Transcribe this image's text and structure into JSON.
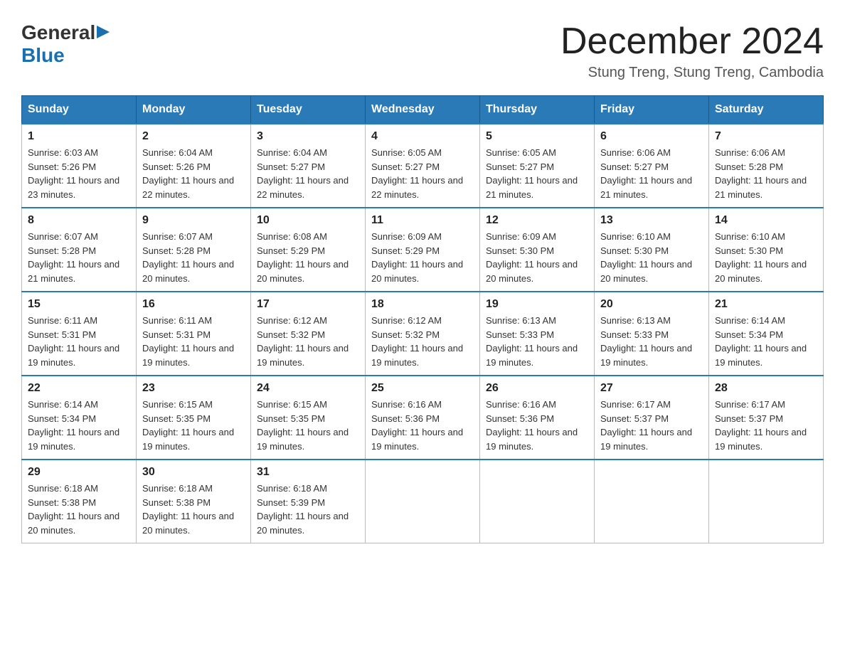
{
  "logo": {
    "general": "General",
    "blue": "Blue",
    "triangle": "▶"
  },
  "title": {
    "month": "December 2024",
    "location": "Stung Treng, Stung Treng, Cambodia"
  },
  "headers": [
    "Sunday",
    "Monday",
    "Tuesday",
    "Wednesday",
    "Thursday",
    "Friday",
    "Saturday"
  ],
  "weeks": [
    [
      {
        "day": "1",
        "sunrise": "6:03 AM",
        "sunset": "5:26 PM",
        "daylight": "11 hours and 23 minutes."
      },
      {
        "day": "2",
        "sunrise": "6:04 AM",
        "sunset": "5:26 PM",
        "daylight": "11 hours and 22 minutes."
      },
      {
        "day": "3",
        "sunrise": "6:04 AM",
        "sunset": "5:27 PM",
        "daylight": "11 hours and 22 minutes."
      },
      {
        "day": "4",
        "sunrise": "6:05 AM",
        "sunset": "5:27 PM",
        "daylight": "11 hours and 22 minutes."
      },
      {
        "day": "5",
        "sunrise": "6:05 AM",
        "sunset": "5:27 PM",
        "daylight": "11 hours and 21 minutes."
      },
      {
        "day": "6",
        "sunrise": "6:06 AM",
        "sunset": "5:27 PM",
        "daylight": "11 hours and 21 minutes."
      },
      {
        "day": "7",
        "sunrise": "6:06 AM",
        "sunset": "5:28 PM",
        "daylight": "11 hours and 21 minutes."
      }
    ],
    [
      {
        "day": "8",
        "sunrise": "6:07 AM",
        "sunset": "5:28 PM",
        "daylight": "11 hours and 21 minutes."
      },
      {
        "day": "9",
        "sunrise": "6:07 AM",
        "sunset": "5:28 PM",
        "daylight": "11 hours and 20 minutes."
      },
      {
        "day": "10",
        "sunrise": "6:08 AM",
        "sunset": "5:29 PM",
        "daylight": "11 hours and 20 minutes."
      },
      {
        "day": "11",
        "sunrise": "6:09 AM",
        "sunset": "5:29 PM",
        "daylight": "11 hours and 20 minutes."
      },
      {
        "day": "12",
        "sunrise": "6:09 AM",
        "sunset": "5:30 PM",
        "daylight": "11 hours and 20 minutes."
      },
      {
        "day": "13",
        "sunrise": "6:10 AM",
        "sunset": "5:30 PM",
        "daylight": "11 hours and 20 minutes."
      },
      {
        "day": "14",
        "sunrise": "6:10 AM",
        "sunset": "5:30 PM",
        "daylight": "11 hours and 20 minutes."
      }
    ],
    [
      {
        "day": "15",
        "sunrise": "6:11 AM",
        "sunset": "5:31 PM",
        "daylight": "11 hours and 19 minutes."
      },
      {
        "day": "16",
        "sunrise": "6:11 AM",
        "sunset": "5:31 PM",
        "daylight": "11 hours and 19 minutes."
      },
      {
        "day": "17",
        "sunrise": "6:12 AM",
        "sunset": "5:32 PM",
        "daylight": "11 hours and 19 minutes."
      },
      {
        "day": "18",
        "sunrise": "6:12 AM",
        "sunset": "5:32 PM",
        "daylight": "11 hours and 19 minutes."
      },
      {
        "day": "19",
        "sunrise": "6:13 AM",
        "sunset": "5:33 PM",
        "daylight": "11 hours and 19 minutes."
      },
      {
        "day": "20",
        "sunrise": "6:13 AM",
        "sunset": "5:33 PM",
        "daylight": "11 hours and 19 minutes."
      },
      {
        "day": "21",
        "sunrise": "6:14 AM",
        "sunset": "5:34 PM",
        "daylight": "11 hours and 19 minutes."
      }
    ],
    [
      {
        "day": "22",
        "sunrise": "6:14 AM",
        "sunset": "5:34 PM",
        "daylight": "11 hours and 19 minutes."
      },
      {
        "day": "23",
        "sunrise": "6:15 AM",
        "sunset": "5:35 PM",
        "daylight": "11 hours and 19 minutes."
      },
      {
        "day": "24",
        "sunrise": "6:15 AM",
        "sunset": "5:35 PM",
        "daylight": "11 hours and 19 minutes."
      },
      {
        "day": "25",
        "sunrise": "6:16 AM",
        "sunset": "5:36 PM",
        "daylight": "11 hours and 19 minutes."
      },
      {
        "day": "26",
        "sunrise": "6:16 AM",
        "sunset": "5:36 PM",
        "daylight": "11 hours and 19 minutes."
      },
      {
        "day": "27",
        "sunrise": "6:17 AM",
        "sunset": "5:37 PM",
        "daylight": "11 hours and 19 minutes."
      },
      {
        "day": "28",
        "sunrise": "6:17 AM",
        "sunset": "5:37 PM",
        "daylight": "11 hours and 19 minutes."
      }
    ],
    [
      {
        "day": "29",
        "sunrise": "6:18 AM",
        "sunset": "5:38 PM",
        "daylight": "11 hours and 20 minutes."
      },
      {
        "day": "30",
        "sunrise": "6:18 AM",
        "sunset": "5:38 PM",
        "daylight": "11 hours and 20 minutes."
      },
      {
        "day": "31",
        "sunrise": "6:18 AM",
        "sunset": "5:39 PM",
        "daylight": "11 hours and 20 minutes."
      },
      null,
      null,
      null,
      null
    ]
  ]
}
